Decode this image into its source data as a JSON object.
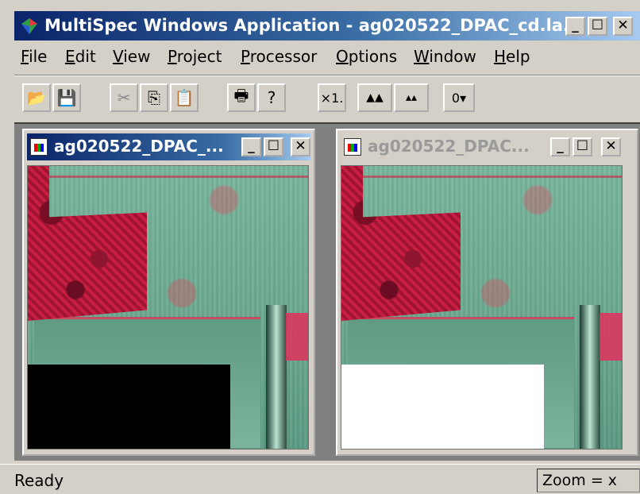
{
  "window": {
    "title": "MultiSpec Windows Application - ag020522_DPAC_cd.la...",
    "controls": {
      "minimize": "_",
      "maximize": "☐",
      "close": "✕"
    }
  },
  "menu": {
    "items": [
      {
        "label_first": "F",
        "label_rest": "ile"
      },
      {
        "label_first": "E",
        "label_rest": "dit"
      },
      {
        "label_first": "V",
        "label_rest": "iew"
      },
      {
        "label_first": "P",
        "label_rest": "roject"
      },
      {
        "label_first": "P",
        "label_rest": "rocessor"
      },
      {
        "label_first": "O",
        "label_rest": "ptions"
      },
      {
        "label_first": "W",
        "label_rest": "indow"
      },
      {
        "label_first": "H",
        "label_rest": "elp"
      }
    ]
  },
  "toolbar": {
    "buttons": [
      {
        "icon": "open-folder-icon",
        "glyph": "📂",
        "enabled": true
      },
      {
        "icon": "save-icon",
        "glyph": "💾",
        "enabled": false
      },
      {
        "icon": "cut-icon",
        "glyph": "✂",
        "enabled": false
      },
      {
        "icon": "copy-icon",
        "glyph": "⎘",
        "enabled": true
      },
      {
        "icon": "paste-icon",
        "glyph": "📋",
        "enabled": false
      },
      {
        "icon": "print-icon",
        "glyph": "🖶",
        "enabled": true
      },
      {
        "icon": "help-icon",
        "glyph": "?",
        "enabled": true
      },
      {
        "icon": "zoom-x1-icon",
        "glyph": "×1.",
        "enabled": true
      },
      {
        "icon": "zoom-in-histogram-icon",
        "glyph": "▲▲",
        "enabled": true
      },
      {
        "icon": "zoom-out-histogram-icon",
        "glyph": "▴▴",
        "enabled": true
      },
      {
        "icon": "overlay-menu-icon",
        "glyph": "0▾",
        "enabled": true
      }
    ]
  },
  "children": [
    {
      "title": "ag020522_DPAC_...",
      "active": true,
      "mask_color": "black"
    },
    {
      "title": "ag020522_DPAC...",
      "active": false,
      "mask_color": "white"
    }
  ],
  "status": {
    "text": "Ready",
    "zoom": "Zoom = x"
  }
}
